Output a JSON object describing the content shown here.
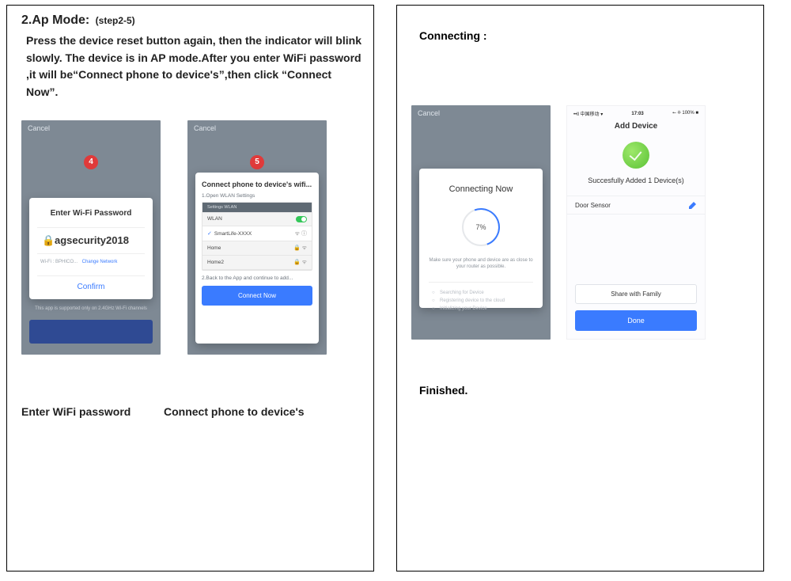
{
  "left": {
    "heading_main": "2.Ap Mode:",
    "heading_sub": "(step2-5)",
    "instructions": "Press the device reset button again, then the indicator will blink slowly. The device is in AP mode.After you enter WiFi password ,it will be“Connect phone to device's”,then click “Connect Now”.",
    "phone4": {
      "cancel": "Cancel",
      "step_num": "4",
      "card_title": "Enter Wi-Fi Password",
      "password": "agsecurity2018",
      "net_prefix": "Wi-Fi : BPHICO...",
      "change_network": "Change Network",
      "confirm": "Confirm",
      "footer_note": "This app is supported only on 2.4GHz Wi-Fi channels"
    },
    "phone5": {
      "cancel": "Cancel",
      "step_num": "5",
      "card_title": "Connect phone to device's wifi...",
      "step1": "1.Open WLAN Settings",
      "wlan_header": "Settings    WLAN",
      "wlan_toggle": "WLAN",
      "wlan_selected": "SmartLife-XXXX",
      "wlan_other1": "Home",
      "wlan_other2": "Home2",
      "step2": "2.Back to the App and continue to add...",
      "connect_now": "Connect Now"
    },
    "caption4": "Enter WiFi password",
    "caption5": "Connect phone to device's"
  },
  "right": {
    "heading": "Connecting :",
    "phoneC": {
      "cancel": "Cancel",
      "card_title": "Connecting Now",
      "percent": "7%",
      "hint": "Make sure your phone and device are as close to your router as possible.",
      "s1": "Searching for Device",
      "s2": "Registering device to the cloud",
      "s3": "Initializing your Device"
    },
    "phoneD": {
      "status_left": "••ll 中国移动 ▾",
      "status_mid": "17:03",
      "status_right": "⭠ ✻ 100% ■",
      "title": "Add Device",
      "success": "Succesfully Added 1 Device(s)",
      "device_name": "Door Sensor",
      "share": "Share with Family",
      "done": "Done"
    },
    "finished": "Finished."
  }
}
